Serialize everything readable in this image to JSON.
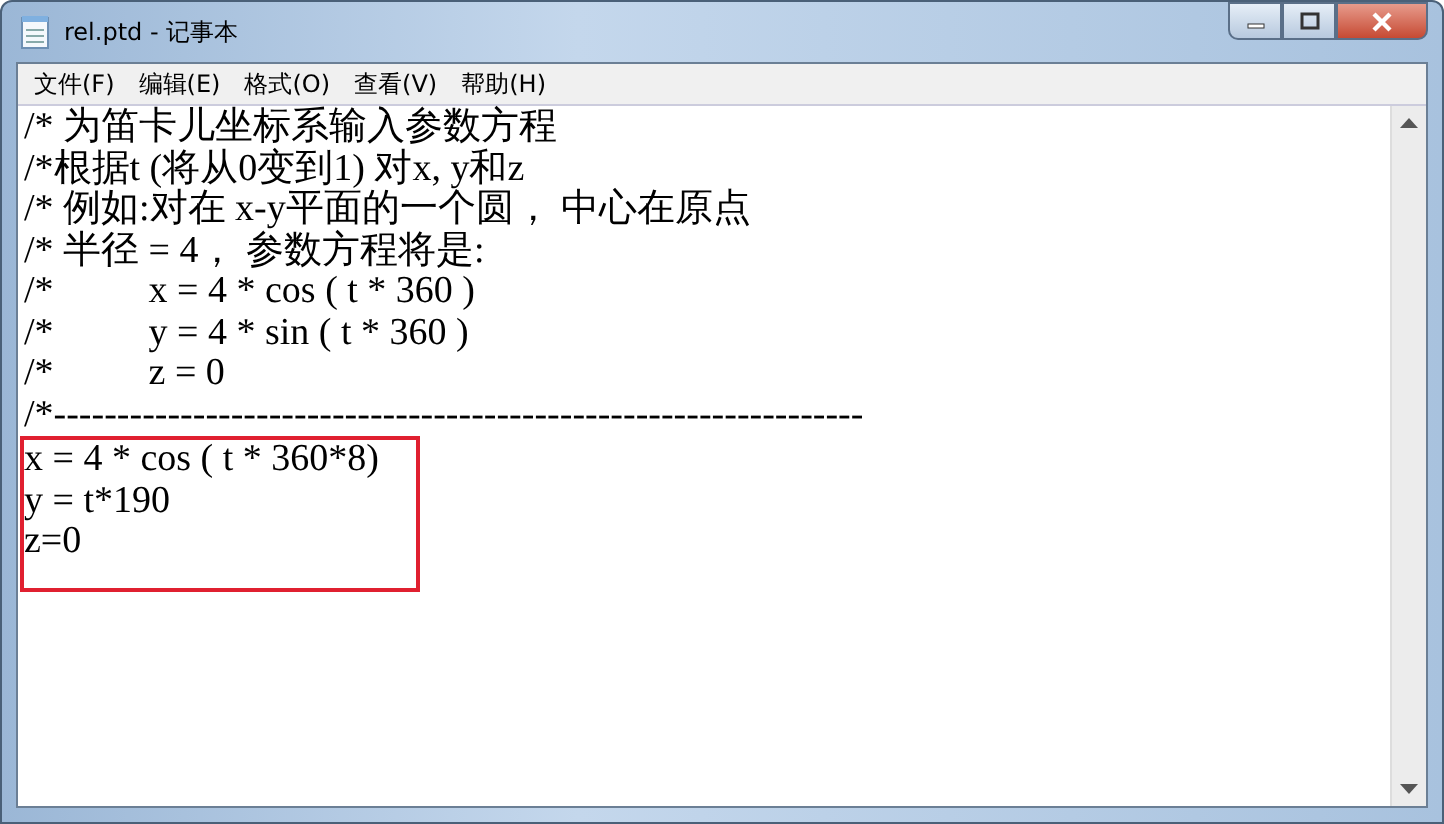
{
  "window": {
    "title": "rel.ptd - 记事本"
  },
  "menu": [
    "文件(F)",
    "编辑(E)",
    "格式(O)",
    "查看(V)",
    "帮助(H)"
  ],
  "lines": [
    "/* 为笛卡儿坐标系输入参数方程",
    "/*根据t (将从0变到1) 对x, y和z",
    "/* 例如:对在 x-y平面的一个圆， 中心在原点",
    "/* 半径 = 4， 参数方程将是:",
    "/*          x = 4 * cos ( t * 360 )",
    "/*          y = 4 * sin ( t * 360 )",
    "/*          z = 0",
    "/*----------------------------------------------------------------"
  ],
  "highlighted_block": {
    "lines": [
      "x = 4 * cos ( t * 360*8)",
      "y = t*190",
      "z=0"
    ]
  }
}
